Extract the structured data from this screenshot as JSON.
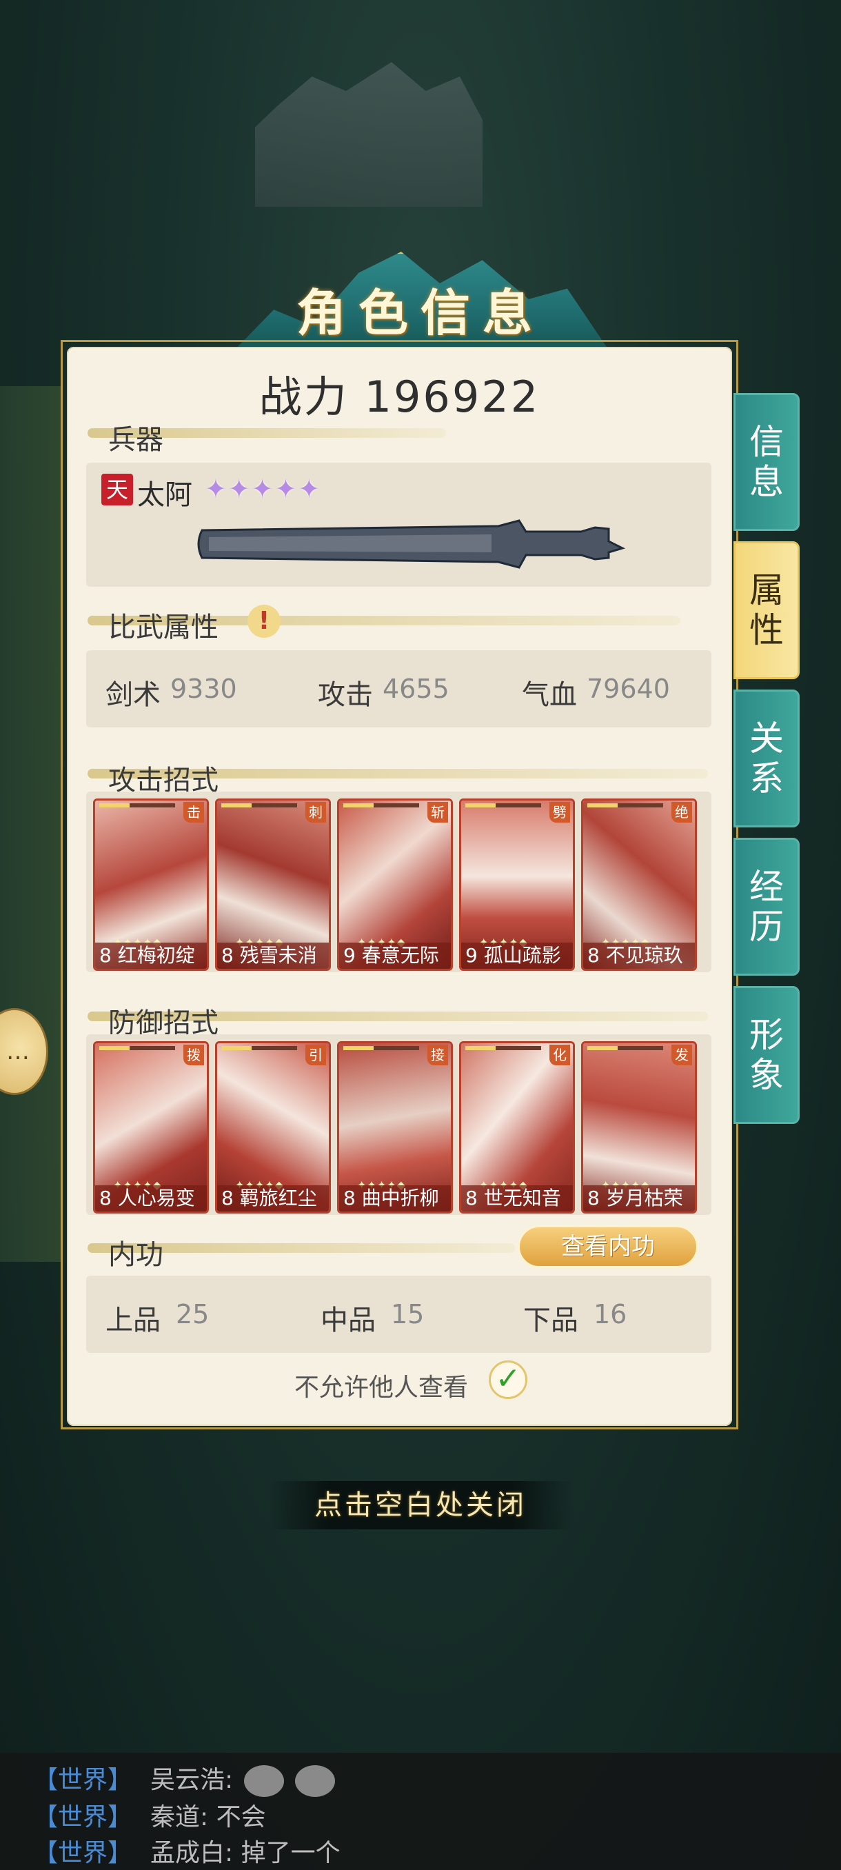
{
  "panel": {
    "title": "角色信息",
    "power": "战力 196922",
    "close_hint": "点击空白处关闭"
  },
  "weapon": {
    "section": "兵器",
    "tier": "天",
    "name": "太阿",
    "stars": "✦✦✦✦✦"
  },
  "combat": {
    "section": "比武属性",
    "alert": "!",
    "stats": [
      {
        "label": "剑术",
        "value": "9330"
      },
      {
        "label": "攻击",
        "value": "4655"
      },
      {
        "label": "气血",
        "value": "79640"
      }
    ]
  },
  "attack_moves": {
    "section": "攻击招式",
    "cards": [
      {
        "type": "击",
        "level": "8",
        "name": "红梅初绽",
        "stars": "✦✦✦✦◆"
      },
      {
        "type": "刺",
        "level": "8",
        "name": "残雪未消",
        "stars": "✦✦✦✦◆"
      },
      {
        "type": "斩",
        "level": "9",
        "name": "春意无际",
        "stars": "✦✦✦✦◆"
      },
      {
        "type": "劈",
        "level": "9",
        "name": "孤山疏影",
        "stars": "✦✦✦✦◆"
      },
      {
        "type": "绝",
        "level": "8",
        "name": "不见琼玖",
        "stars": "✦✦✦✦◆"
      }
    ]
  },
  "defense_moves": {
    "section": "防御招式",
    "cards": [
      {
        "type": "拨",
        "level": "8",
        "name": "人心易变",
        "stars": "✦✦✦✦◆"
      },
      {
        "type": "引",
        "level": "8",
        "name": "羁旅红尘",
        "stars": "✦✦✦✦◆"
      },
      {
        "type": "接",
        "level": "8",
        "name": "曲中折柳",
        "stars": "✦✦✦✦◆"
      },
      {
        "type": "化",
        "level": "8",
        "name": "世无知音",
        "stars": "✦✦✦✦◆"
      },
      {
        "type": "发",
        "level": "8",
        "name": "岁月枯荣",
        "stars": "✦✦✦✦◆"
      }
    ]
  },
  "neigong": {
    "section": "内功",
    "view_button": "查看内功",
    "stats": [
      {
        "label": "上品",
        "value": "25"
      },
      {
        "label": "中品",
        "value": "15"
      },
      {
        "label": "下品",
        "value": "16"
      }
    ],
    "privacy_label": "不允许他人查看",
    "privacy_checked": true
  },
  "tabs": [
    {
      "line1": "信",
      "line2": "息",
      "active": false
    },
    {
      "line1": "属",
      "line2": "性",
      "active": true
    },
    {
      "line1": "关",
      "line2": "系",
      "active": false
    },
    {
      "line1": "经",
      "line2": "历",
      "active": false
    },
    {
      "line1": "形",
      "line2": "象",
      "active": false
    }
  ],
  "chat": [
    {
      "channel": "【世界】",
      "sender": "吴云浩:",
      "text": ""
    },
    {
      "channel": "【世界】",
      "sender": "秦道:",
      "text": "不会"
    },
    {
      "channel": "【世界】",
      "sender": "孟成白:",
      "text": "掉了一个"
    }
  ]
}
